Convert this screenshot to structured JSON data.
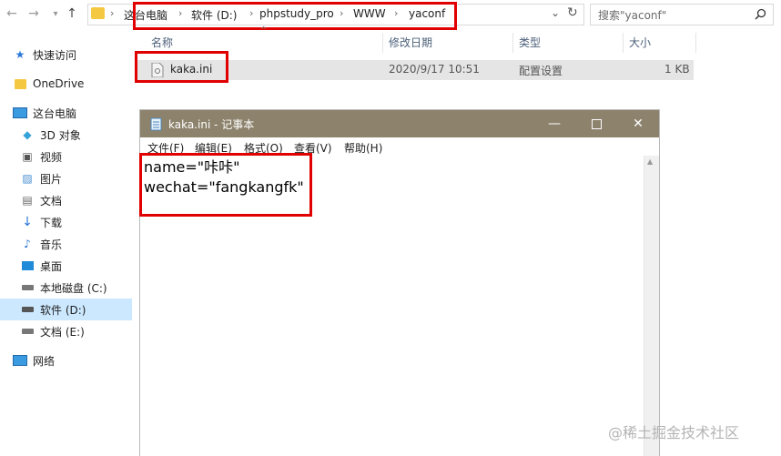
{
  "nav": {
    "back_icon": "arrow-left",
    "forward_icon": "arrow-right",
    "dropdown_icon": "chevron-down",
    "up_icon": "arrow-up"
  },
  "address": {
    "breadcrumbs": [
      "这台电脑",
      "软件 (D:)",
      "phpstudy_pro",
      "WWW",
      "yaconf"
    ]
  },
  "search": {
    "placeholder": "搜索\"yaconf\""
  },
  "sidebar": {
    "items": [
      {
        "label": "快速访问",
        "icon": "star-icon"
      },
      {
        "label": "OneDrive",
        "icon": "cloud-folder-icon"
      },
      {
        "label": "这台电脑",
        "icon": "computer-icon"
      },
      {
        "label": "3D 对象",
        "icon": "cube-icon"
      },
      {
        "label": "视频",
        "icon": "video-icon"
      },
      {
        "label": "图片",
        "icon": "picture-icon"
      },
      {
        "label": "文档",
        "icon": "document-icon"
      },
      {
        "label": "下载",
        "icon": "download-icon"
      },
      {
        "label": "音乐",
        "icon": "music-icon"
      },
      {
        "label": "桌面",
        "icon": "desktop-icon"
      },
      {
        "label": "本地磁盘 (C:)",
        "icon": "drive-icon"
      },
      {
        "label": "软件 (D:)",
        "icon": "drive-icon"
      },
      {
        "label": "文档 (E:)",
        "icon": "drive-icon"
      },
      {
        "label": "网络",
        "icon": "network-icon"
      }
    ]
  },
  "filelist": {
    "columns": [
      "名称",
      "修改日期",
      "类型",
      "大小"
    ],
    "rows": [
      {
        "name": "kaka.ini",
        "modified": "2020/9/17 10:51",
        "type": "配置设置",
        "size": "1 KB"
      }
    ]
  },
  "notepad": {
    "title": "kaka.ini - 记事本",
    "menu": [
      "文件(F)",
      "编辑(E)",
      "格式(O)",
      "查看(V)",
      "帮助(H)"
    ],
    "lines": [
      "name=\"咔咔\"",
      "wechat=\"fangkangfk\""
    ]
  },
  "watermark": "@稀土掘金技术社区",
  "colors": {
    "highlight": "#e10000",
    "titlebar": "#8d836d",
    "selection": "#cce8ff"
  }
}
